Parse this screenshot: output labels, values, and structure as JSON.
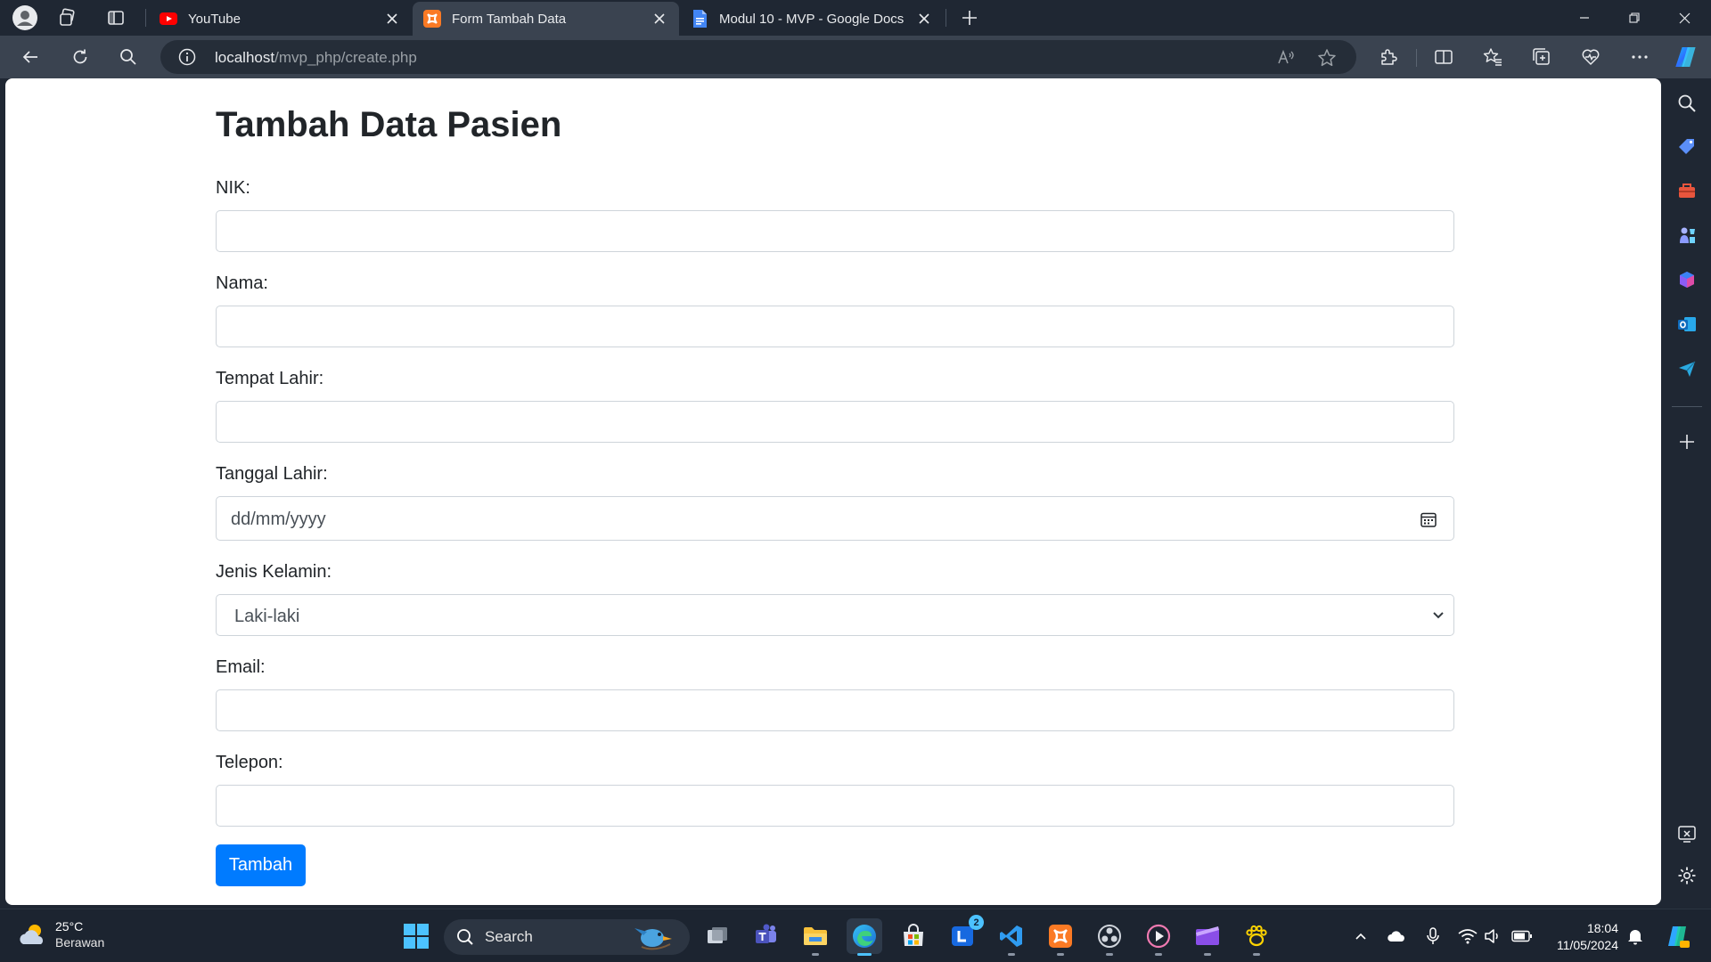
{
  "browser": {
    "tabs": [
      {
        "title": "YouTube",
        "icon": "youtube-icon",
        "active": false
      },
      {
        "title": "Form Tambah Data",
        "icon": "xampp-icon",
        "active": true
      },
      {
        "title": "Modul 10 - MVP - Google Docs",
        "icon": "google-docs-icon",
        "active": false
      }
    ],
    "url_host": "localhost",
    "url_path": "/mvp_php/create.php"
  },
  "page": {
    "title": "Tambah Data Pasien",
    "fields": {
      "nik": {
        "label": "NIK:",
        "value": ""
      },
      "nama": {
        "label": "Nama:",
        "value": ""
      },
      "tempat_lahir": {
        "label": "Tempat Lahir:",
        "value": ""
      },
      "tanggal_lahir": {
        "label": "Tanggal Lahir:",
        "placeholder": "dd/mm/yyyy"
      },
      "jenis_kelamin": {
        "label": "Jenis Kelamin:",
        "selected": "Laki-laki"
      },
      "email": {
        "label": "Email:",
        "value": ""
      },
      "telepon": {
        "label": "Telepon:",
        "value": ""
      }
    },
    "submit_label": "Tambah",
    "accent_color": "#007bff"
  },
  "taskbar": {
    "weather_temp": "25°C",
    "weather_desc": "Berawan",
    "search_label": "Search",
    "mail_badge": "2",
    "time": "18:04",
    "date": "11/05/2024"
  }
}
